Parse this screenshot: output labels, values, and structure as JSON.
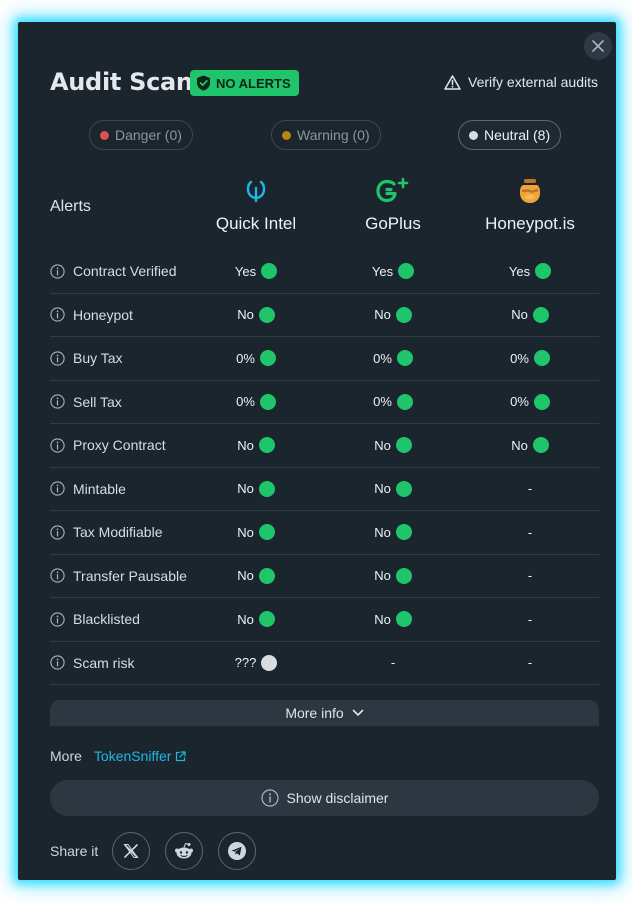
{
  "header": {
    "title": "Audit Scan",
    "badge": "NO ALERTS",
    "verify_label": "Verify external audits"
  },
  "filters": [
    {
      "label": "Danger (0)",
      "color": "#d9534f"
    },
    {
      "label": "Warning (0)",
      "color": "#b8860b"
    },
    {
      "label": "Neutral (8)",
      "color": "#d9dde1"
    }
  ],
  "table": {
    "alerts_label": "Alerts",
    "providers": [
      {
        "name": "Quick Intel",
        "icon": "quick-intel-logo",
        "color": "#1fb8e6"
      },
      {
        "name": "GoPlus",
        "icon": "goplus-logo",
        "color": "#1fc56a"
      },
      {
        "name": "Honeypot.is",
        "icon": "honeypot-jar-logo",
        "color": "#e8a33a"
      }
    ],
    "rows": [
      {
        "label": "Contract Verified",
        "values": [
          "Yes",
          "Yes",
          "Yes"
        ],
        "status": [
          "green",
          "green",
          "green"
        ]
      },
      {
        "label": "Honeypot",
        "values": [
          "No",
          "No",
          "No"
        ],
        "status": [
          "green",
          "green",
          "green"
        ]
      },
      {
        "label": "Buy Tax",
        "values": [
          "0%",
          "0%",
          "0%"
        ],
        "status": [
          "green",
          "green",
          "green"
        ]
      },
      {
        "label": "Sell Tax",
        "values": [
          "0%",
          "0%",
          "0%"
        ],
        "status": [
          "green",
          "green",
          "green"
        ]
      },
      {
        "label": "Proxy Contract",
        "values": [
          "No",
          "No",
          "No"
        ],
        "status": [
          "green",
          "green",
          "green"
        ]
      },
      {
        "label": "Mintable",
        "values": [
          "No",
          "No",
          "-"
        ],
        "status": [
          "green",
          "green",
          "none"
        ]
      },
      {
        "label": "Tax Modifiable",
        "values": [
          "No",
          "No",
          "-"
        ],
        "status": [
          "green",
          "green",
          "none"
        ]
      },
      {
        "label": "Transfer Pausable",
        "values": [
          "No",
          "No",
          "-"
        ],
        "status": [
          "green",
          "green",
          "none"
        ]
      },
      {
        "label": "Blacklisted",
        "values": [
          "No",
          "No",
          "-"
        ],
        "status": [
          "green",
          "green",
          "none"
        ]
      },
      {
        "label": "Scam risk",
        "values": [
          "???",
          "-",
          "-"
        ],
        "status": [
          "grey",
          "none",
          "none"
        ]
      }
    ]
  },
  "more_info_label": "More info",
  "more": {
    "label": "More",
    "link_label": "TokenSniffer"
  },
  "disclaimer_label": "Show disclaimer",
  "share": {
    "label": "Share it",
    "buttons": [
      "x-icon",
      "reddit-icon",
      "telegram-icon"
    ]
  },
  "colors": {
    "background": "#1b252d",
    "accent_green": "#1fc56a",
    "link_blue": "#1fb8e6",
    "glow": "#00d7ff"
  }
}
